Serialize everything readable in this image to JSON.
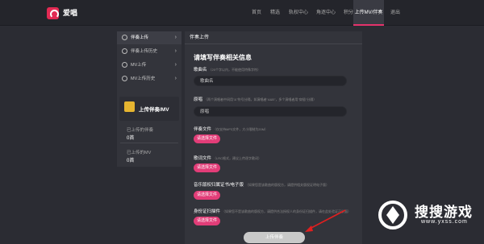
{
  "app": {
    "name": "爱唱"
  },
  "nav": {
    "items": [
      {
        "label": "首页",
        "active": false
      },
      {
        "label": "精选",
        "active": false
      },
      {
        "label": "轨权中心",
        "active": false
      },
      {
        "label": "角逐中心",
        "active": false
      },
      {
        "label": "积分商城",
        "active": false
      },
      {
        "label": "上传MV/伴奏",
        "active": true
      },
      {
        "label": "退出",
        "active": false
      }
    ]
  },
  "sidebar": {
    "items": [
      {
        "label": "伴奏上传",
        "active": true
      },
      {
        "label": "伴奏上传历史",
        "active": false
      },
      {
        "label": "MV上传",
        "active": false
      },
      {
        "label": "MV上传历史",
        "active": false
      }
    ],
    "card_title": "上传伴奏/MV",
    "stats": [
      {
        "label": "已上传的伴奏",
        "value": "0首"
      },
      {
        "label": "已上传的MV",
        "value": "0首"
      }
    ]
  },
  "panel": {
    "header": "伴奏上传",
    "title": "请填写伴奏相关信息",
    "song_name_label": "歌曲名",
    "song_name_hint": "（20个字以内，不能使用特殊字符）",
    "song_name_value": "歌曲名",
    "singer_label": "原唱",
    "singer_hint": "（两个演唱者中间用\"&\"符号分隔，如演唱者\"A&B\"，多个演唱者用\"穿插\"分隔）",
    "singer_value": "原唱",
    "accomp_file_label": "伴奏文件",
    "accomp_file_hint": "（仅支持MP3文件，大小限制为20M）",
    "lyrics_file_label": "歌词文件",
    "lyrics_file_hint": "（LRC格式，建议上传逐字歌词）",
    "auth_label": "音乐版权归属证书/电子版",
    "auth_hint": "（如果您是该歌曲的版权方，请提供相关版权证明电子版）",
    "id_label": "身份证扫描件",
    "id_hint": "（如果您不是该歌曲的版权方，请提供合法授权人的身份证扫描件，请在此处验证正反面）",
    "pick_button": "请选择文件",
    "submit": "上传伴奏"
  },
  "watermark": {
    "text": "搜搜游戏",
    "url": "www.yxss.com"
  },
  "colors": {
    "accent": "#e23d78",
    "nav_active_underline": "#e4336b",
    "logo": "#e22a53"
  }
}
